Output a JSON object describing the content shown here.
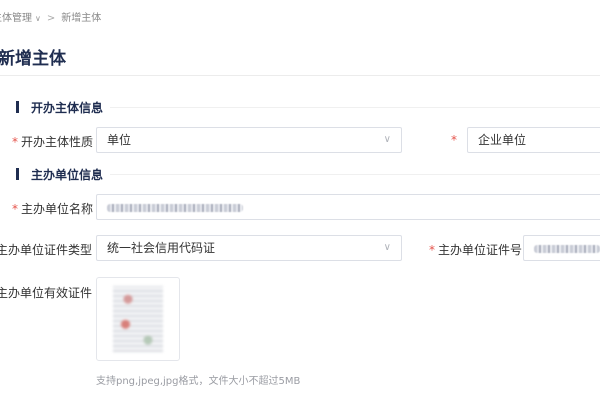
{
  "breadcrumb": {
    "parent": "主体管理",
    "current": "新增主体"
  },
  "page": {
    "title": "新增主体"
  },
  "sections": {
    "opening": {
      "title": "开办主体信息"
    },
    "sponsor": {
      "title": "主办单位信息"
    }
  },
  "form": {
    "opening_nature": {
      "label": "开办主体性质",
      "value": "单位"
    },
    "unit_category": {
      "value": "企业单位"
    },
    "sponsor_name": {
      "label": "主办单位名称"
    },
    "cert_type": {
      "label": "主办单位证件类型",
      "value": "统一社会信用代码证"
    },
    "cert_number": {
      "label": "主办单位证件号"
    },
    "valid_cert": {
      "label": "主办单位有效证件"
    }
  },
  "upload": {
    "hint": "支持png,jpeg,jpg格式，文件大小不超过5MB"
  },
  "icons": {
    "chevron": "chevron-down-icon",
    "breadcrumb_separator": ">"
  },
  "colors": {
    "required": "#e5534b",
    "heading": "#1f2d50",
    "border": "#dcdfe6"
  }
}
